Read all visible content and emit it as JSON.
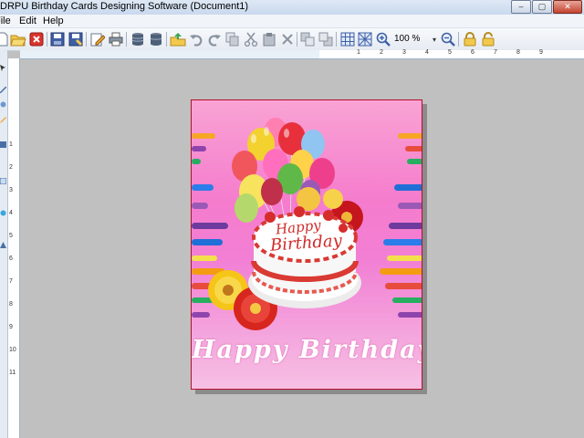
{
  "window": {
    "title": "DRPU Birthday Cards Designing Software  (Document1)",
    "min_glyph": "–",
    "max_glyph": "▢",
    "close_glyph": "✕"
  },
  "menu": {
    "items": [
      {
        "label": "File"
      },
      {
        "label": "Edit"
      },
      {
        "label": "Help"
      }
    ]
  },
  "toolbar": {
    "zoom_value": "100 %",
    "zoom_dropdown_glyph": "▾",
    "icons": [
      "new-icon",
      "open-icon",
      "close-icon",
      "save-icon",
      "save-as-icon",
      "edit-icon",
      "print-icon",
      "database-icon",
      "database-export-icon",
      "export-icon",
      "undo-icon",
      "redo-icon",
      "copy-icon",
      "cut-icon",
      "paste-icon",
      "delete-icon",
      "bring-front-icon",
      "send-back-icon",
      "grid-icon",
      "snap-grid-icon",
      "zoom-in-icon",
      "zoom-out-icon",
      "lock-icon",
      "unlock-icon"
    ]
  },
  "ruler": {
    "h_labels": [
      "1",
      "2",
      "3",
      "4",
      "5",
      "6",
      "7",
      "8",
      "9"
    ],
    "v_labels": [
      "1",
      "2",
      "3",
      "4",
      "5",
      "6",
      "7",
      "8",
      "9",
      "10",
      "11"
    ]
  },
  "card": {
    "greeting": "Happy Birthday",
    "cake_line1": "Happy",
    "cake_line2": "Birthday",
    "border_color": "#b50f2c"
  }
}
